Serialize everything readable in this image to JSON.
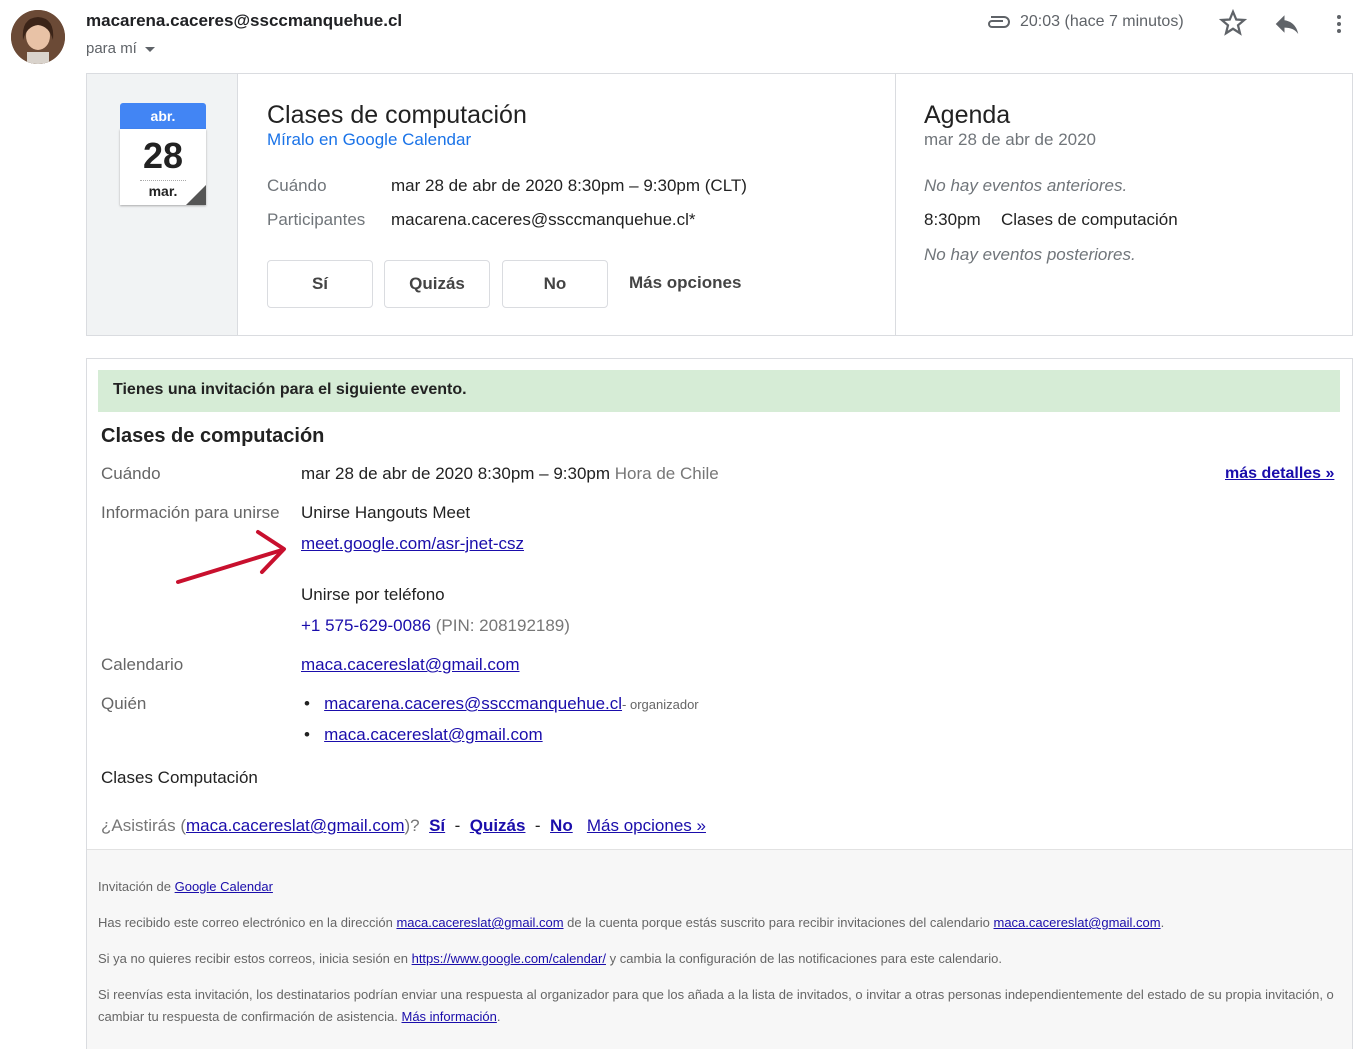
{
  "header": {
    "sender": "macarena.caceres@ssccmanquehue.cl",
    "to": "para mí",
    "time": "20:03 (hace 7 minutos)"
  },
  "card": {
    "cal_month": "abr.",
    "cal_day": "28",
    "cal_dow": "mar.",
    "title": "Clases de computación",
    "calendar_link": "Míralo en Google Calendar",
    "when_label": "Cuándo",
    "when_value": "mar 28 de abr de 2020 8:30pm – 9:30pm (CLT)",
    "guests_label": "Participantes",
    "guests_value": "macarena.caceres@ssccmanquehue.cl*",
    "btn_yes": "Sí",
    "btn_maybe": "Quizás",
    "btn_no": "No",
    "btn_more": "Más opciones"
  },
  "agenda": {
    "title": "Agenda",
    "date": "mar 28 de abr de 2020",
    "prev": "No hay eventos anteriores.",
    "event_time": "8:30pm",
    "event_title": "Clases de computación",
    "next": "No hay eventos posteriores."
  },
  "invite": {
    "notice": "Tienes una invitación para el siguiente evento.",
    "title": "Clases de computación",
    "when_label": "Cuándo",
    "when_value": "mar 28 de abr de 2020 8:30pm – 9:30pm",
    "when_tz": "Hora de Chile",
    "more_details": "más detalles »",
    "join_label": "Información para unirse",
    "join_title": "Unirse Hangouts Meet",
    "meet_link": "meet.google.com/asr-jnet-csz",
    "phone_title": "Unirse por teléfono",
    "phone_number": "+1 575-629-0086",
    "phone_pin": "(PIN: 208192189)",
    "calendar_label": "Calendario",
    "calendar_value": "maca.cacereslat@gmail.com",
    "who_label": "Quién",
    "who_1": "macarena.caceres@ssccmanquehue.cl",
    "who_1_role": "- organizador",
    "who_2": "maca.cacereslat@gmail.com",
    "description": "Clases Computación",
    "ask_prefix": "¿Asistirás (",
    "ask_email": "maca.cacereslat@gmail.com",
    "ask_suffix": ")?",
    "ask_yes": "Sí",
    "ask_maybe": "Quizás",
    "ask_no": "No",
    "ask_sep": "-",
    "ask_more": "Más opciones »"
  },
  "footer": {
    "f1_prefix": "Invitación de ",
    "f1_link": "Google Calendar",
    "f2_a": "Has recibido este correo electrónico en la dirección ",
    "f2_link1": "maca.cacereslat@gmail.com",
    "f2_b": " de la cuenta porque estás suscrito para recibir invitaciones del calendario ",
    "f2_link2": "maca.cacereslat@gmail.com",
    "f2_c": ".",
    "f3_a": "Si ya no quieres recibir estos correos, inicia sesión en ",
    "f3_link": "https://www.google.com/calendar/",
    "f3_b": " y cambia la configuración de las notificaciones para este calendario.",
    "f4_a": "Si reenvías esta invitación, los destinatarios podrían enviar una respuesta al organizador para que los añada a la lista de invitados, o invitar a otras personas independientemente del estado de su propia invitación, o cambiar tu respuesta de confirmación de asistencia. ",
    "f4_link": "Más información",
    "f4_b": "."
  },
  "colors": {
    "accent_blue": "#4285f4",
    "link_blue": "#1a0dab",
    "notice_green": "#d6ecd6",
    "arrow_red": "#c8102e"
  }
}
